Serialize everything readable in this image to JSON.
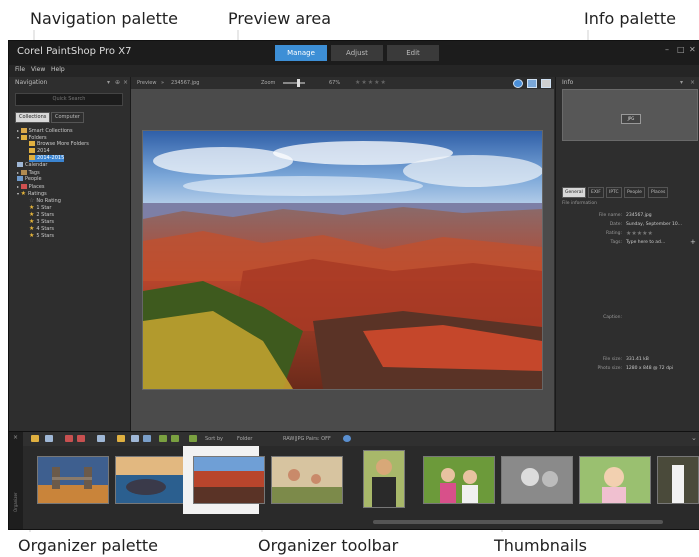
{
  "callouts": {
    "navigation_palette": "Navigation palette",
    "preview_area": "Preview area",
    "info_palette": "Info palette",
    "organizer_palette": "Organizer palette",
    "organizer_toolbar": "Organizer toolbar",
    "thumbnails": "Thumbnails"
  },
  "app": {
    "title": "Corel PaintShop Pro X7",
    "workspace_tabs": [
      "Manage",
      "Adjust",
      "Edit"
    ],
    "active_workspace": "Manage",
    "menu": [
      "File",
      "View",
      "Help"
    ]
  },
  "navigation": {
    "title": "Navigation",
    "search_placeholder": "Quick Search",
    "tabs": [
      "Collections",
      "Computer"
    ],
    "tree": [
      "Smart Collections",
      "Folders",
      "Browse More Folders",
      "2014",
      "2014-2015",
      "Calendar",
      "Tags",
      "People",
      "Places",
      "Ratings",
      "No Rating",
      "1 Star",
      "2 Stars",
      "3 Stars",
      "4 Stars",
      "5 Stars"
    ]
  },
  "preview": {
    "label": "Preview",
    "filename": "234567.jpg",
    "zoom_label": "Zoom",
    "zoom_value": "67%",
    "rating_stars": "★★★★★"
  },
  "info": {
    "title": "Info",
    "badge": "JPG",
    "tabs": [
      "General",
      "EXIF",
      "IPTC",
      "People",
      "Places"
    ],
    "section": "File information",
    "fields": {
      "file_name_label": "File name:",
      "file_name": "234567.jpg",
      "date_label": "Date:",
      "date": "Sunday, September 10...",
      "rating_label": "Rating:",
      "rating": "★★★★★",
      "tags_label": "Tags:",
      "tags": "Type here to ad...",
      "caption_label": "Caption:",
      "file_size_label": "File size:",
      "file_size": "331.41 kB",
      "photo_size_label": "Photo size:",
      "photo_size": "1280 x 848 @ 72 dpi"
    }
  },
  "organizer": {
    "side_label": "Organizer",
    "sort_label": "Sort by",
    "sort_value": "Folder",
    "raw_label": "RAW|JPG Pairs: OFF"
  },
  "colors": {
    "accent": "#3d8fd6",
    "panel_bg": "#2e2e2e",
    "preview_bg": "#4b4b4b"
  }
}
